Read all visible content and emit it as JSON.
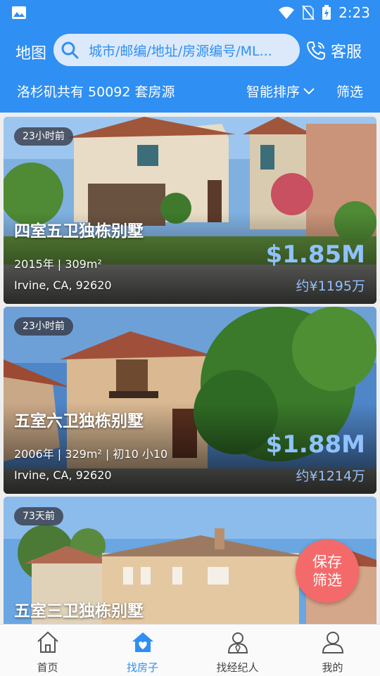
{
  "status_bar": {
    "time": "2:23"
  },
  "header": {
    "map_label": "地图",
    "search_placeholder": "城市/邮编/地址/房源编号/ML...",
    "service_label": "客服",
    "count_text": "洛杉矶共有 50092 套房源",
    "sort_label": "智能排序",
    "filter_label": "筛选"
  },
  "listings": [
    {
      "badge": "23小时前",
      "title": "四室五卫独栋别墅",
      "meta": "2015年 | 309m²",
      "address": "Irvine, CA, 92620",
      "price": "$1.85M",
      "price_cny": "约¥1195万"
    },
    {
      "badge": "23小时前",
      "title": "五室六卫独栋别墅",
      "meta": "2006年 | 329m² | 初10 小10",
      "address": "Irvine, CA, 92620",
      "price": "$1.88M",
      "price_cny": "约¥1214万"
    },
    {
      "badge": "73天前",
      "title": "五室三卫独栋别墅"
    }
  ],
  "fab": {
    "line1": "保存",
    "line2": "筛选"
  },
  "tabbar": {
    "items": [
      {
        "label": "首页",
        "icon": "home-icon"
      },
      {
        "label": "找房子",
        "icon": "house-heart-icon"
      },
      {
        "label": "找经纪人",
        "icon": "agent-icon"
      },
      {
        "label": "我的",
        "icon": "user-icon"
      }
    ]
  },
  "colors": {
    "primary": "#2f8ff2",
    "price": "#8fc2ff",
    "fab": "#f46a6a"
  }
}
